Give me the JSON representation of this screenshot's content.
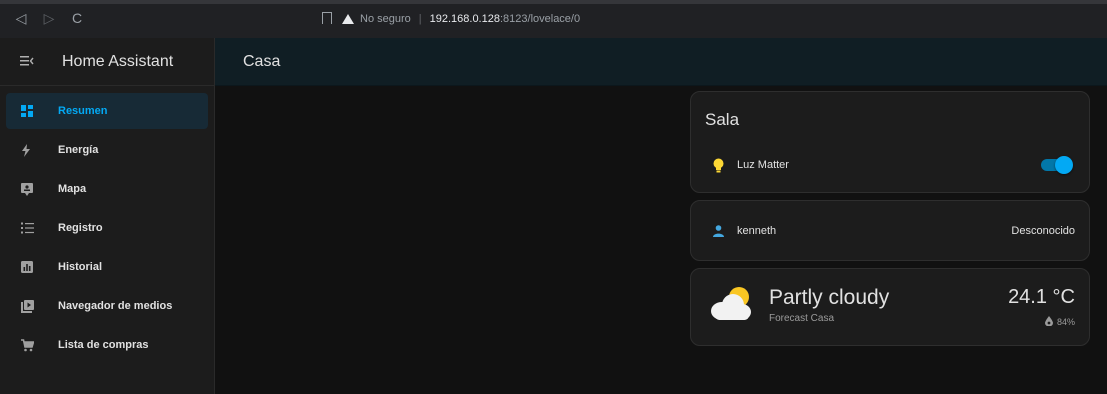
{
  "browser": {
    "back_glyph": "◁",
    "forward_glyph": "▷",
    "reload_glyph": "C",
    "security_label": "No seguro",
    "url_host": "192.168.0.128",
    "url_rest": ":8123/lovelace/0"
  },
  "sidebar": {
    "app_title": "Home Assistant",
    "items": [
      {
        "label": "Resumen",
        "icon": "dashboard-icon",
        "active": true
      },
      {
        "label": "Energía",
        "icon": "lightning-bolt-icon",
        "active": false
      },
      {
        "label": "Mapa",
        "icon": "map-icon",
        "active": false
      },
      {
        "label": "Registro",
        "icon": "logbook-icon",
        "active": false
      },
      {
        "label": "Historial",
        "icon": "history-chart-icon",
        "active": false
      },
      {
        "label": "Navegador de medios",
        "icon": "media-player-icon",
        "active": false
      },
      {
        "label": "Lista de compras",
        "icon": "cart-icon",
        "active": false
      }
    ]
  },
  "header": {
    "title": "Casa"
  },
  "cards": {
    "sala": {
      "title": "Sala",
      "entity_label": "Luz Matter",
      "entity_icon": "lightbulb-icon",
      "toggle_on": true
    },
    "person": {
      "name": "kenneth",
      "state": "Desconocido",
      "icon": "person-icon"
    },
    "weather": {
      "condition": "Partly cloudy",
      "source": "Forecast Casa",
      "temperature": "24.1 °C",
      "humidity": "84%"
    }
  },
  "colors": {
    "accent": "#03a9f4",
    "bulb": "#fdd835",
    "person": "#44a8e0"
  }
}
